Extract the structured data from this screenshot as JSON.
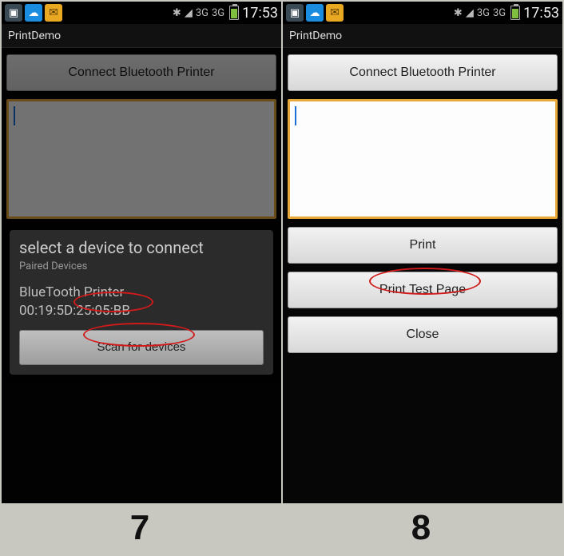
{
  "statusbar": {
    "clock": "17:53"
  },
  "app": {
    "title": "PrintDemo",
    "connect_btn": "Connect Bluetooth Printer",
    "print_btn": "Print",
    "print_test_btn": "Print Test Page",
    "close_btn": "Close",
    "textarea_value": ""
  },
  "dialog": {
    "title": "select a device to connect",
    "subtitle": "Paired Devices",
    "device_name": "BlueTooth Printer",
    "device_mac": "00:19:5D:25:05:BB",
    "scan_btn": "Scan for devices"
  },
  "figure": {
    "left_num": "7",
    "right_num": "8"
  }
}
